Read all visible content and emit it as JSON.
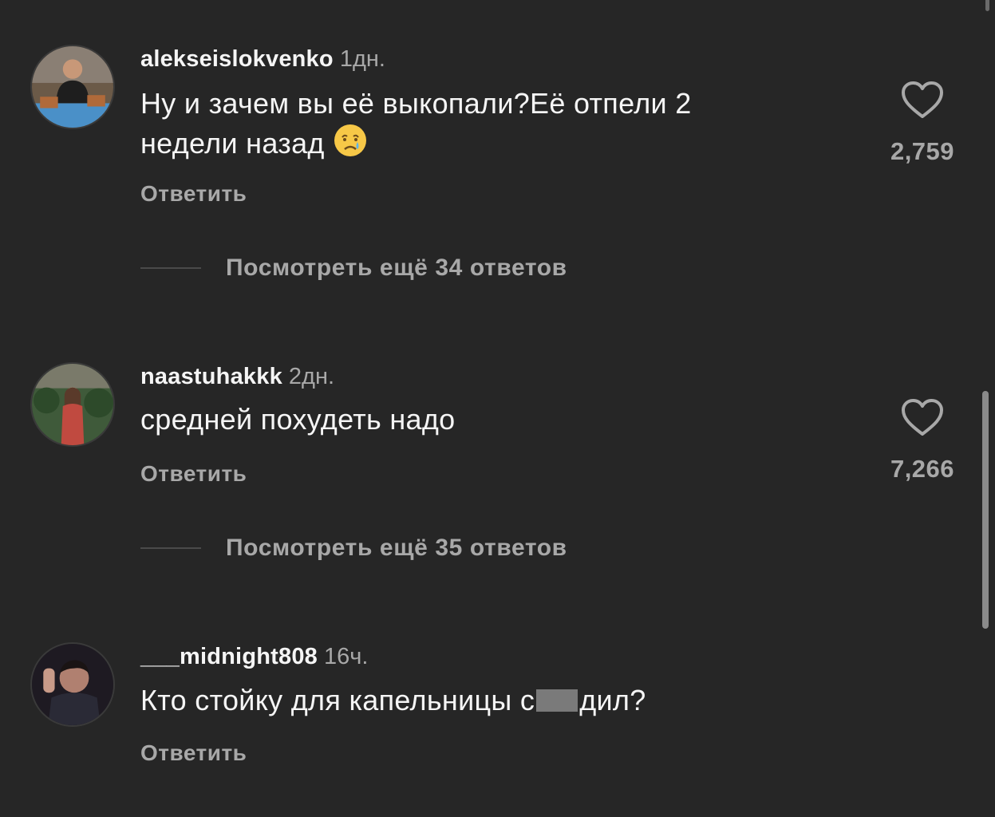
{
  "comments": [
    {
      "username": "alekseislokvenko",
      "time": "1дн.",
      "text_line1": "Ну и зачем вы её выкопали?Её отпели  2",
      "text_line2": "недели назад",
      "emoji": "crying-face-emoji",
      "reply_label": "Ответить",
      "likes": "2,759",
      "view_more": "Посмотреть ещё 34 ответов"
    },
    {
      "username": "naastuhakkk",
      "time": "2дн.",
      "text_line1": "средней похудеть надо",
      "reply_label": "Ответить",
      "likes": "7,266",
      "view_more": "Посмотреть ещё 35 ответов"
    },
    {
      "username": "___midnight808",
      "time": "16ч.",
      "text_before_censor": "Кто стойку для капельницы с",
      "text_after_censor": "дил?",
      "reply_label": "Ответить"
    }
  ],
  "icons": {
    "like": "heart-outline-icon"
  },
  "colors": {
    "background": "#262626",
    "primary_text": "#f5f5f5",
    "secondary_text": "#a8a8a8"
  }
}
